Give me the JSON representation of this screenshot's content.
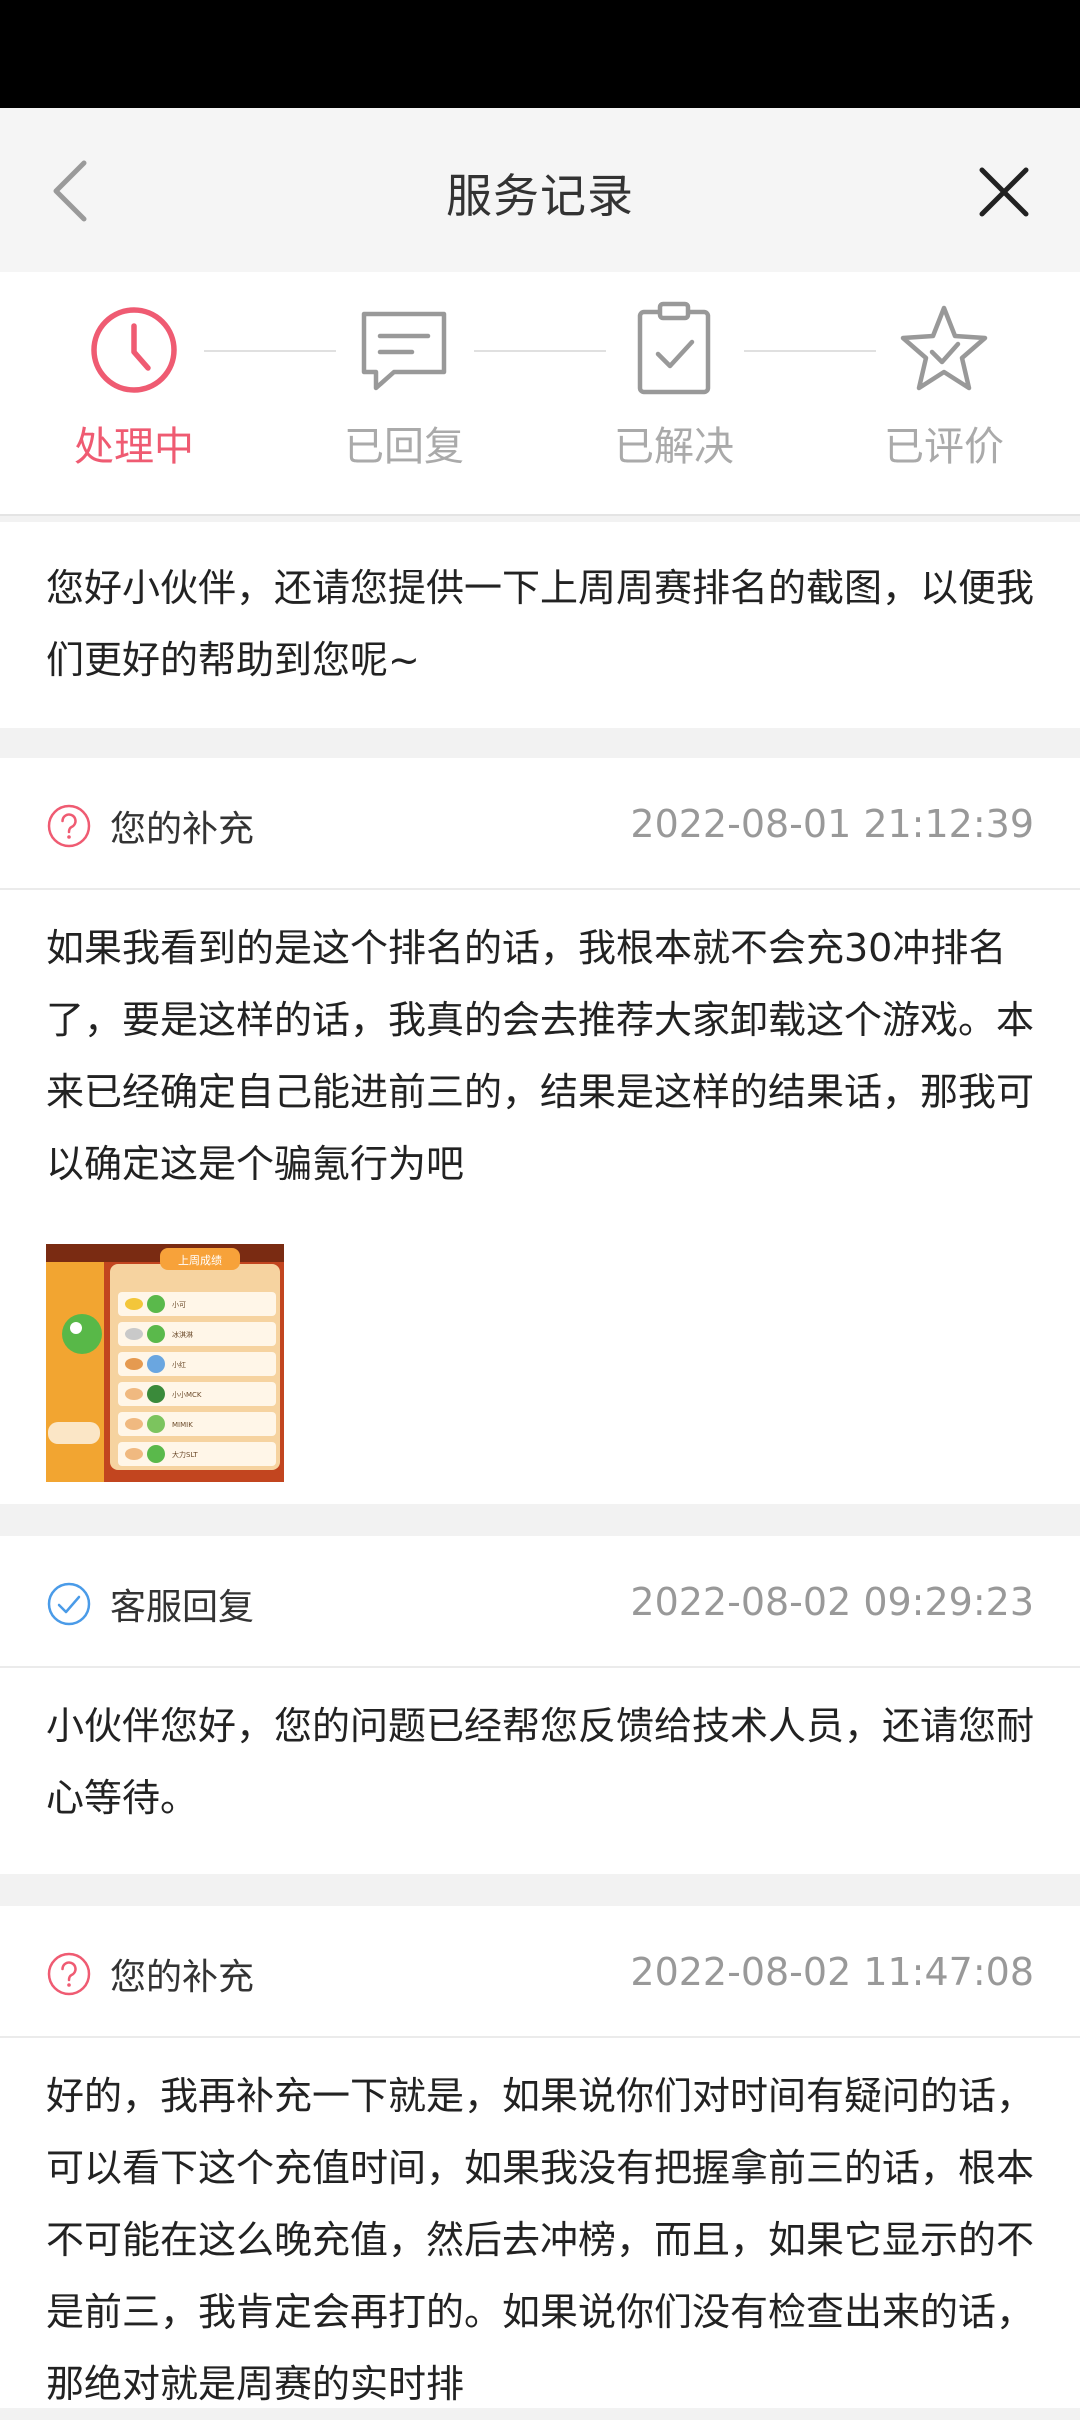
{
  "nav": {
    "title": "服务记录",
    "back_icon": "chevron-left-icon",
    "close_icon": "close-icon"
  },
  "steps": [
    {
      "label": "处理中",
      "icon": "clock-icon",
      "active": true
    },
    {
      "label": "已回复",
      "icon": "message-icon",
      "active": false
    },
    {
      "label": "已解决",
      "icon": "clipboard-check-icon",
      "active": false
    },
    {
      "label": "已评价",
      "icon": "star-check-icon",
      "active": false
    }
  ],
  "colors": {
    "accent": "#ef5b72",
    "inactive": "#aaaaaa",
    "service_blue": "#4a9be8"
  },
  "records": [
    {
      "text": "您好小伙伴，还请您提供一下上周周赛排名的截图，以便我们更好的帮助到您呢~"
    },
    {
      "type": "您的补充",
      "icon": "question-circle-icon",
      "time": "2022-08-01 21:12:39",
      "text": "如果我看到的是这个排名的话，我根本就不会充30冲排名了，要是这样的话，我真的会去推荐大家卸载这个游戏。本来已经确定自己能进前三的，结果是这样的结果话，那我可以确定这是个骗氪行为吧",
      "attachment": {
        "header": "上周成绩",
        "rows": [
          "小可",
          "冰淇淋",
          "小红",
          "小小MCK",
          "MIMIK",
          "大力SLT"
        ]
      }
    },
    {
      "type": "客服回复",
      "icon": "check-circle-icon",
      "time": "2022-08-02 09:29:23",
      "text": "小伙伴您好，您的问题已经帮您反馈给技术人员，还请您耐心等待。"
    },
    {
      "type": "您的补充",
      "icon": "question-circle-icon",
      "time": "2022-08-02 11:47:08",
      "text": "好的，我再补充一下就是，如果说你们对时间有疑问的话，可以看下这个充值时间，如果我没有把握拿前三的话，根本不可能在这么晚充值，然后去冲榜，而且，如果它显示的不是前三，我肯定会再打的。如果说你们没有检查出来的话，那绝对就是周赛的实时排"
    }
  ]
}
